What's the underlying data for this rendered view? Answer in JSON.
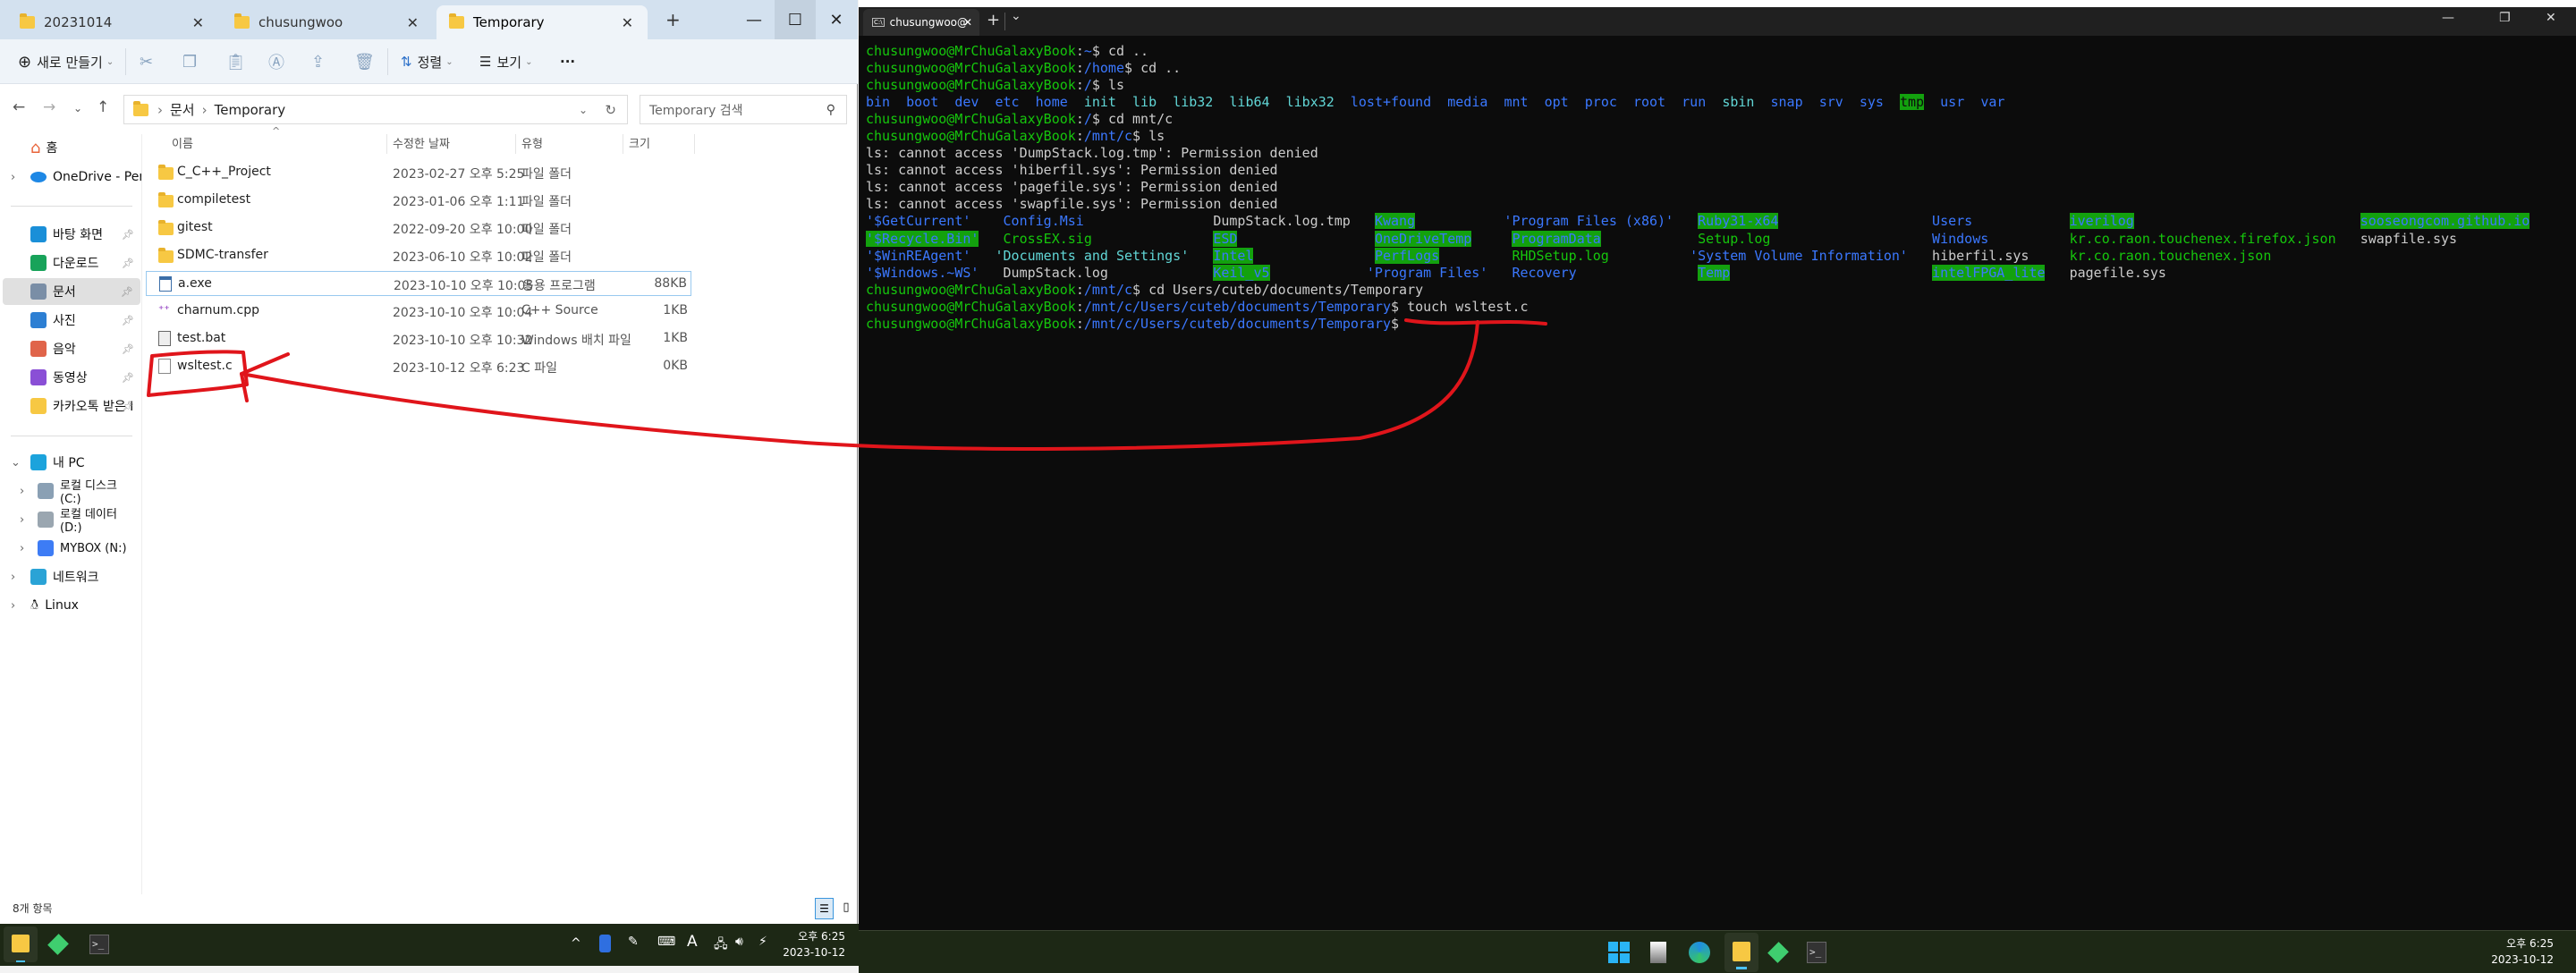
{
  "explorer": {
    "tabs": [
      {
        "label": "20231014"
      },
      {
        "label": "chusungwoo"
      },
      {
        "label": "Temporary",
        "active": true
      }
    ],
    "new_tab": "+",
    "toolbar": {
      "new_label": "새로 만들기",
      "sort_label": "정렬",
      "view_label": "보기",
      "more_label": "···"
    },
    "address": {
      "crumbs": [
        "문서",
        "Temporary"
      ]
    },
    "search": {
      "placeholder": "Temporary 검색"
    },
    "sidebar": {
      "home": "홈",
      "onedrive": "OneDrive - Personal",
      "quick": [
        {
          "label": "바탕 화면",
          "icon": "desktop-icon",
          "color": "#1a8fd8"
        },
        {
          "label": "다운로드",
          "icon": "download-icon",
          "color": "#18a35a"
        },
        {
          "label": "문서",
          "icon": "documents-icon",
          "color": "#7a8ea6",
          "selected": true
        },
        {
          "label": "사진",
          "icon": "pictures-icon",
          "color": "#2d7fd3"
        },
        {
          "label": "음악",
          "icon": "music-icon",
          "color": "#e0644a"
        },
        {
          "label": "동영상",
          "icon": "videos-icon",
          "color": "#8a4fd6"
        },
        {
          "label": "카카오톡 받은 I",
          "icon": "folder-icon",
          "color": "#f7c843"
        }
      ],
      "this_pc": "내 PC",
      "drives": [
        {
          "label": "로컬 디스크 (C:)",
          "icon": "drive-c-icon"
        },
        {
          "label": "로컬 데이터 (D:)",
          "icon": "drive-d-icon"
        },
        {
          "label": "MYBOX (N:)",
          "icon": "mybox-icon"
        }
      ],
      "network": "네트워크",
      "linux": "Linux"
    },
    "columns": [
      "이름",
      "수정한 날짜",
      "유형",
      "크기"
    ],
    "files": [
      {
        "name": "C_C++_Project",
        "date": "2023-02-27 오후 5:25",
        "type": "파일 폴더",
        "size": "",
        "icon": "folder"
      },
      {
        "name": "compiletest",
        "date": "2023-01-06 오후 1:11",
        "type": "파일 폴더",
        "size": "",
        "icon": "folder"
      },
      {
        "name": "gitest",
        "date": "2022-09-20 오후 10:00",
        "type": "파일 폴더",
        "size": "",
        "icon": "folder"
      },
      {
        "name": "SDMC-transfer",
        "date": "2023-06-10 오후 10:02",
        "type": "파일 폴더",
        "size": "",
        "icon": "folder"
      },
      {
        "name": "a.exe",
        "date": "2023-10-10 오후 10:05",
        "type": "응용 프로그램",
        "size": "88KB",
        "icon": "exe",
        "selected": true
      },
      {
        "name": "charnum.cpp",
        "date": "2023-10-10 오후 10:04",
        "type": "C++ Source",
        "size": "1KB",
        "icon": "cpp"
      },
      {
        "name": "test.bat",
        "date": "2023-10-10 오후 10:32",
        "type": "Windows 배치 파일",
        "size": "1KB",
        "icon": "bat"
      },
      {
        "name": "wsltest.c",
        "date": "2023-10-12 오후 6:23",
        "type": "C 파일",
        "size": "0KB",
        "icon": "file"
      }
    ],
    "status": "8개 항목"
  },
  "taskbar_left": {
    "time": "오후 6:25",
    "date": "2023-10-12",
    "tray_a": "A",
    "tray_up": "^"
  },
  "taskbar_right": {
    "time": "오후 6:25",
    "date": "2023-10-12"
  },
  "terminal": {
    "tab_title": "chusungwoo@MrChuGalaxyBook",
    "new_tab": "+",
    "dropdown": "⌄",
    "user": "chusungwoo@MrChuGalaxyBook",
    "lines": [
      {
        "path": "~",
        "cmd": "cd .."
      },
      {
        "path": "/home",
        "cmd": "cd .."
      },
      {
        "path": "/",
        "cmd": "ls"
      },
      {
        "ls": [
          [
            "bin",
            "dir"
          ],
          [
            "boot",
            "dir"
          ],
          [
            "dev",
            "dir"
          ],
          [
            "etc",
            "dir"
          ],
          [
            "home",
            "dir"
          ],
          [
            "init",
            "link"
          ],
          [
            "lib",
            "link"
          ],
          [
            "lib32",
            "link"
          ],
          [
            "lib64",
            "link"
          ],
          [
            "libx32",
            "link"
          ],
          [
            "lost+found",
            "dir"
          ],
          [
            "media",
            "dir"
          ],
          [
            "mnt",
            "dir"
          ],
          [
            "opt",
            "dir"
          ],
          [
            "proc",
            "dir"
          ],
          [
            "root",
            "dir"
          ],
          [
            "run",
            "dir"
          ],
          [
            "sbin",
            "link"
          ],
          [
            "snap",
            "dir"
          ],
          [
            "srv",
            "dir"
          ],
          [
            "sys",
            "dir"
          ],
          [
            "tmp",
            "sticky"
          ],
          [
            "usr",
            "dir"
          ],
          [
            "var",
            "dir"
          ]
        ]
      },
      {
        "path": "/",
        "cmd": "cd mnt/c"
      },
      {
        "path": "/mnt/c",
        "cmd": "ls"
      },
      {
        "text": "ls: cannot access 'DumpStack.log.tmp': Permission denied"
      },
      {
        "text": "ls: cannot access 'hiberfil.sys': Permission denied"
      },
      {
        "text": "ls: cannot access 'pagefile.sys': Permission denied"
      },
      {
        "text": "ls: cannot access 'swapfile.sys': Permission denied"
      },
      {
        "grid": [
          [
            [
              "'$GetCurrent'",
              "dir"
            ],
            [
              "'$Recycle.Bin'",
              "ow"
            ],
            [
              "'$WinREAgent'",
              "dir"
            ],
            [
              "'$Windows.~WS'",
              "dir"
            ]
          ],
          [
            [
              "Config.Msi",
              "dir"
            ],
            [
              "CrossEX.sig",
              "exec"
            ],
            [
              "'Documents and Settings'",
              "link"
            ],
            [
              "DumpStack.log",
              "file"
            ]
          ],
          [
            [
              "DumpStack.log.tmp",
              "file"
            ],
            [
              "ESD",
              "ow"
            ],
            [
              "Intel",
              "ow"
            ],
            [
              "Keil_v5",
              "ow"
            ]
          ],
          [
            [
              "Kwang",
              "ow"
            ],
            [
              "OneDriveTemp",
              "ow"
            ],
            [
              "PerfLogs",
              "ow"
            ],
            [
              "'Program Files'",
              "dir"
            ]
          ],
          [
            [
              "'Program Files (x86)'",
              "dir"
            ],
            [
              "ProgramData",
              "ow"
            ],
            [
              "RHDSetup.log",
              "exec"
            ],
            [
              "Recovery",
              "dir"
            ]
          ],
          [
            [
              "Ruby31-x64",
              "ow"
            ],
            [
              "Setup.log",
              "exec"
            ],
            [
              "'System Volume Information'",
              "dir"
            ],
            [
              "Temp",
              "ow"
            ]
          ],
          [
            [
              "Users",
              "dir"
            ],
            [
              "Windows",
              "dir"
            ],
            [
              "hiberfil.sys",
              "file"
            ],
            [
              "intelFPGA_lite",
              "ow"
            ]
          ],
          [
            [
              "iverilog",
              "ow"
            ],
            [
              "kr.co.raon.touchenex.firefox.json",
              "exec"
            ],
            [
              "kr.co.raon.touchenex.json",
              "exec"
            ],
            [
              "pagefile.sys",
              "file"
            ]
          ],
          [
            [
              "sooseongcom.github.io",
              "ow"
            ],
            [
              "swapfile.sys",
              "file"
            ]
          ]
        ]
      },
      {
        "path": "/mnt/c",
        "cmd": "cd Users/cuteb/documents/Temporary"
      },
      {
        "path": "/mnt/c/Users/cuteb/documents/Temporary",
        "cmd": "touch wsltest.c"
      },
      {
        "path": "/mnt/c/Users/cuteb/documents/Temporary",
        "cmd": ""
      }
    ]
  },
  "colors": {
    "annotation": "#e0151b",
    "prompt_user": "#16c60c",
    "prompt_path": "#3b78ff",
    "taskbar": "#1d2815"
  }
}
